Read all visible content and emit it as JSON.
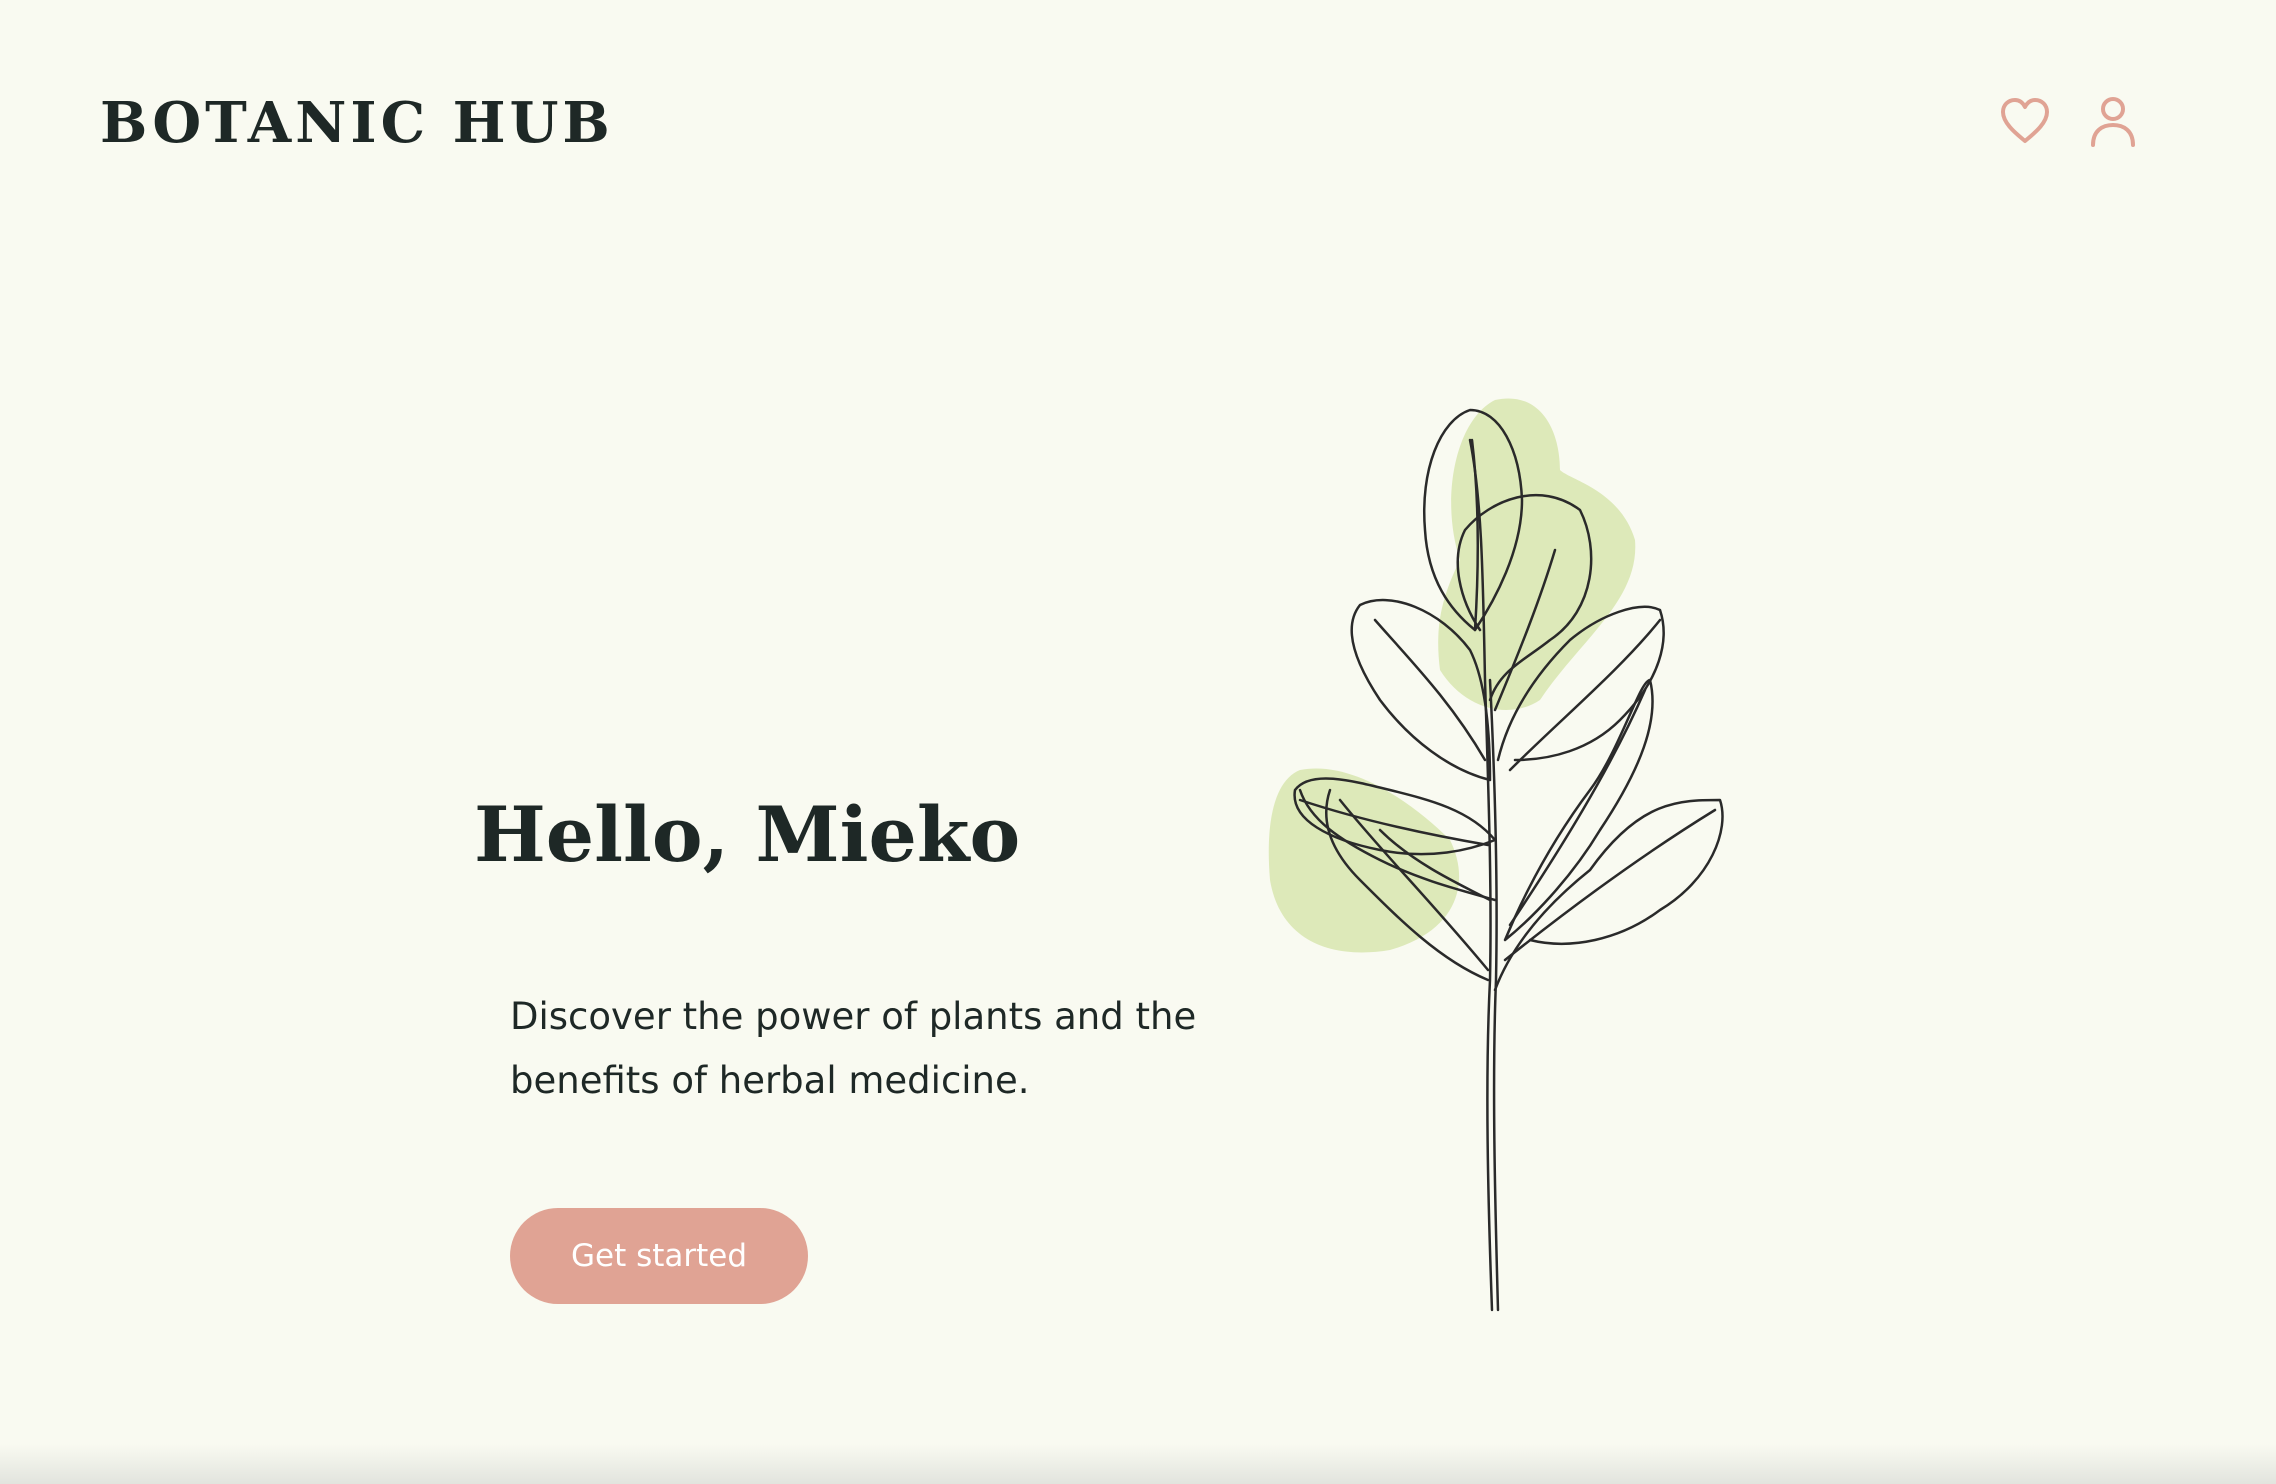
{
  "brand": {
    "logo_text": "BOTANIC HUB"
  },
  "header": {
    "icons": [
      "heart-icon",
      "user-icon"
    ]
  },
  "hero": {
    "greeting": "Hello, Mieko",
    "tagline": "Discover the power of plants and the benefits of herbal medicine.",
    "cta_label": "Get started"
  },
  "colors": {
    "background": "#f9faf1",
    "text": "#1e2826",
    "accent": "#e0a394",
    "leaf_fill": "#dde9b9"
  }
}
